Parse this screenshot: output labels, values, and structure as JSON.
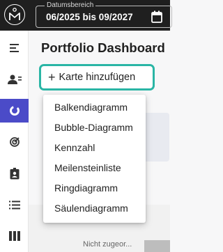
{
  "header": {
    "date_range_label": "Datumsbereich",
    "date_range_value": "06/2025 bis 09/2027"
  },
  "icons": {
    "logo": "logo-icon",
    "calendar": "calendar-icon",
    "menu": "menu-icon",
    "users": "users-icon",
    "dashboard": "dashboard-icon",
    "target": "target-icon",
    "badge": "badge-icon",
    "list": "list-icon",
    "columns": "columns-icon"
  },
  "colors": {
    "header_bg": "#1f1f1f",
    "active_nav": "#4b4bc8",
    "highlight_border": "#2ab5a5"
  },
  "main": {
    "title": "Portfolio Dashboard",
    "add_card_plus": "+",
    "add_card_label": "Karte hinzufügen",
    "background_status": "Nicht zugeor..."
  },
  "menu": {
    "items": [
      "Balkendiagramm",
      "Bubble-Diagramm",
      "Kennzahl",
      "Meilensteinliste",
      "Ringdiagramm",
      "Säulendiagramm"
    ]
  }
}
